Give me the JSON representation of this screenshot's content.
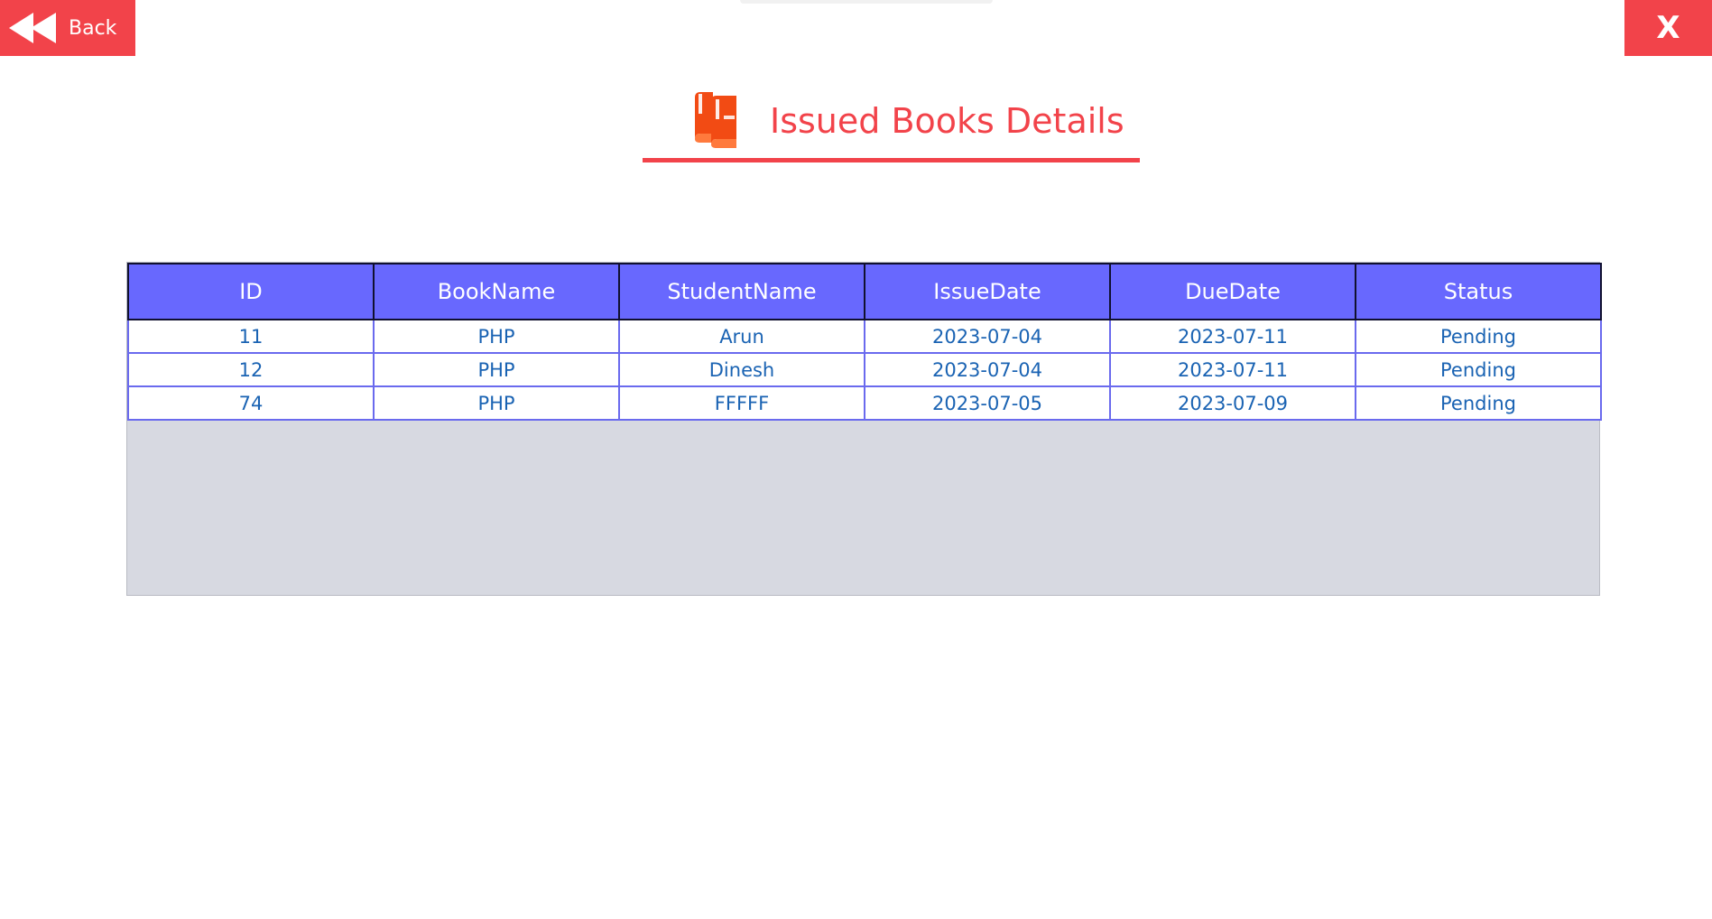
{
  "header": {
    "back_label": "Back",
    "close_label": "X"
  },
  "title": {
    "text": "Issued Books Details",
    "icon": "books-icon"
  },
  "colors": {
    "accent": "#f2434a",
    "header_bg": "#6868fe",
    "cell_text": "#1a63b3",
    "grid_bg": "#d7d9e1"
  },
  "table": {
    "columns": [
      "ID",
      "BookName",
      "StudentName",
      "IssueDate",
      "DueDate",
      "Status"
    ],
    "rows": [
      [
        "11",
        "PHP",
        "Arun",
        "2023-07-04",
        "2023-07-11",
        "Pending"
      ],
      [
        "12",
        "PHP",
        "Dinesh",
        "2023-07-04",
        "2023-07-11",
        "Pending"
      ],
      [
        "74",
        "PHP",
        "FFFFF",
        "2023-07-05",
        "2023-07-09",
        "Pending"
      ]
    ]
  }
}
